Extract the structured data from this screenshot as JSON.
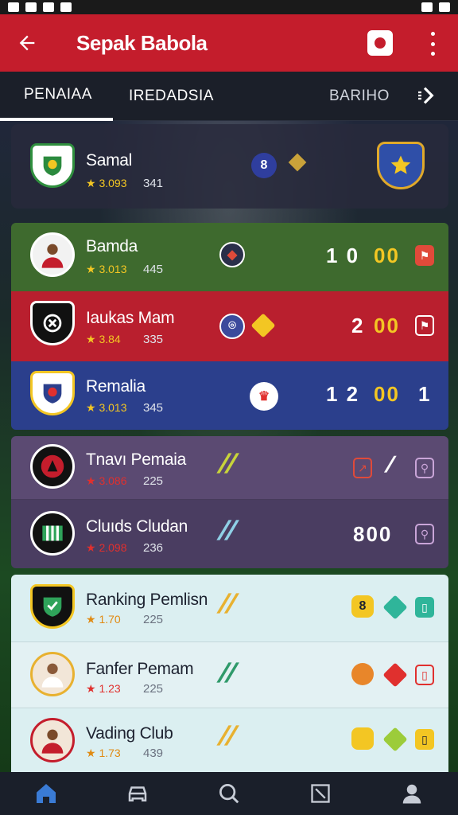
{
  "app": {
    "title": "Sepak Babola"
  },
  "tabs": [
    {
      "label": "PENAIAA"
    },
    {
      "label": "IREDADSIA"
    },
    {
      "label": "BARIHO"
    }
  ],
  "featured": {
    "name": "Samal",
    "rating": "★ 3.093",
    "count": "341",
    "versus_glyph": "8"
  },
  "matches": [
    {
      "name": "Bamda",
      "rating": "★ 3.013",
      "count": "445",
      "score": "1 0",
      "score_hl": "00"
    },
    {
      "name": "Iaukas Mam",
      "rating": "★ 3.84",
      "count": "335",
      "score": "2",
      "score_hl": "00"
    },
    {
      "name": "Remalia",
      "rating": "★ 3.013",
      "count": "345",
      "score": "1 2",
      "score_hl": "00",
      "score_tail": "1"
    }
  ],
  "purple_group": [
    {
      "name": "Tnavı Pemaia",
      "rating": "★ 3.086",
      "count": "225"
    },
    {
      "name": "Cluıds Cludan",
      "rating": "★ 2.098",
      "count": "236",
      "score": "800"
    }
  ],
  "ranking": [
    {
      "name": "Ranking Pemlisn",
      "rating": "★ 1.70",
      "count": "225",
      "score": "8"
    },
    {
      "name": "Fanfer Pemam",
      "rating": "★ 1.23",
      "count": "225"
    },
    {
      "name": "Vading Club",
      "rating": "★ 1.73",
      "count": "439"
    }
  ],
  "colors": {
    "brand_red": "#c41d2c",
    "gold": "#f3c623"
  },
  "nav": [
    {
      "icon": "home-icon"
    },
    {
      "icon": "car-icon"
    },
    {
      "icon": "search-icon"
    },
    {
      "icon": "tablet-icon"
    },
    {
      "icon": "profile-icon"
    }
  ]
}
